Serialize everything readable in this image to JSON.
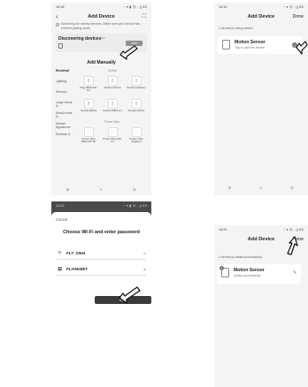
{
  "screen1": {
    "status": {
      "time": "14:18",
      "icons": "◔ ▾ ▮ ⓦ ..|| 83"
    },
    "header": {
      "back": "‹",
      "title": "Add Device",
      "scan": "⛶"
    },
    "hint": "Searching for nearby devices. Make sure your device has entered pairing mode.",
    "discover": {
      "title": "Discovering devices···",
      "add_label": "Add"
    },
    "manual_title": "Add Manually",
    "categories": [
      "Electrical",
      "Lighting",
      "Sensors",
      "Large Home A...",
      "Small Home A...",
      "Kitchen Appliances",
      "Exercise & ..."
    ],
    "col_headers": [
      "Socket",
      "Power Strip"
    ],
    "tiles": [
      {
        "name": "Plug (BLE+Wi-Fi)"
      },
      {
        "name": "Socket (Wi-Fi)"
      },
      {
        "name": "Socket (Zigbee)"
      },
      {
        "name": "Socket (BLE)"
      },
      {
        "name": "Socket (NB-IoT)"
      },
      {
        "name": "Socket (other)"
      },
      {
        "name": "Power Strip (BLE+Wi-Fi)"
      },
      {
        "name": "Power Strip (Wi-Fi)"
      },
      {
        "name": "Power Strip (Zigbee)"
      }
    ],
    "nav": [
      "≡",
      "○",
      "⊃"
    ]
  },
  "screen2": {
    "status": {
      "time": "14:23",
      "icons": "◔ ▾ ▮ ⓦ ..|| 83"
    },
    "cancel": "Cancel",
    "title": "Choose Wi-Fi and enter password",
    "wifi_name": "FLY_XNet",
    "wifi_right": "⇆",
    "password": "FLYHKNET",
    "password_right": "◉",
    "next_label": "Next"
  },
  "screen3": {
    "status": {
      "time": "14:19",
      "icons": "◔ ▾ ⓦ ..|| 83"
    },
    "header": {
      "title": "Add Device",
      "done": "Done"
    },
    "sub": "1 device(s) being added",
    "device": {
      "name": "Motion Sensor",
      "status": "Tap to add the device",
      "badge": "+"
    },
    "nav": [
      "≡",
      "○",
      "⊃"
    ]
  },
  "screen4": {
    "status": {
      "time": "14:24",
      "icons": "◔ ▾ ⓦ ..|| 83"
    },
    "header": {
      "title": "Add Device",
      "done": "Done"
    },
    "sub": "1 device(s) added successfully",
    "device": {
      "name": "Motion Sensor",
      "status": "Added successfully",
      "edit": "✎"
    }
  }
}
